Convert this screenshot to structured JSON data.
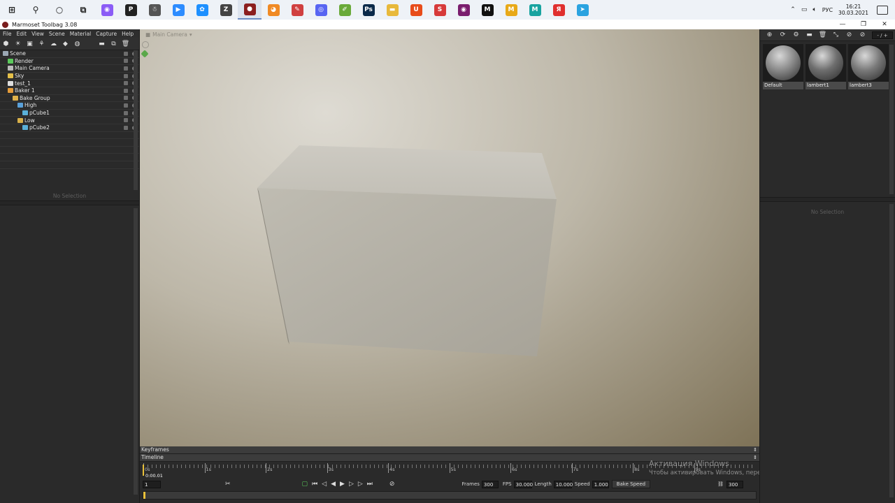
{
  "taskbar": {
    "icons": [
      {
        "name": "windows-start-icon",
        "glyph": "⊞",
        "color": "#222222"
      },
      {
        "name": "search-icon",
        "glyph": "⚲",
        "color": "#222222"
      },
      {
        "name": "cortana-icon",
        "glyph": "○",
        "color": "#222222"
      },
      {
        "name": "task-view-icon",
        "glyph": "⧉",
        "color": "#222222"
      },
      {
        "name": "alice-icon",
        "glyph": "◉",
        "color": "#8b5cf6"
      },
      {
        "name": "chat-app-icon",
        "glyph": "P",
        "color": "#222222"
      },
      {
        "name": "mascot-app-icon",
        "glyph": "☃",
        "color": "#555555"
      },
      {
        "name": "zoom-icon",
        "glyph": "▶",
        "color": "#2d8cff"
      },
      {
        "name": "network-app-icon",
        "glyph": "✿",
        "color": "#1e90ff"
      },
      {
        "name": "zbrush-icon",
        "glyph": "Z",
        "color": "#444444"
      },
      {
        "name": "marmoset-icon",
        "glyph": "●",
        "color": "#8b1e1e"
      },
      {
        "name": "blender-icon",
        "glyph": "◕",
        "color": "#f08a24"
      },
      {
        "name": "paint-app-icon",
        "glyph": "✎",
        "color": "#d04040"
      },
      {
        "name": "discord-icon",
        "glyph": "◎",
        "color": "#5865f2"
      },
      {
        "name": "brush-app-icon",
        "glyph": "✐",
        "color": "#6aaa3a"
      },
      {
        "name": "photoshop-icon",
        "glyph": "Ps",
        "color": "#0b2a4a"
      },
      {
        "name": "folder-icon",
        "glyph": "▬",
        "color": "#e8b93b"
      },
      {
        "name": "ubisoft-icon",
        "glyph": "U",
        "color": "#e84c1a"
      },
      {
        "name": "sp-app-icon",
        "glyph": "S",
        "color": "#d73a3a"
      },
      {
        "name": "obs-icon",
        "glyph": "◉",
        "color": "#7a1d6e"
      },
      {
        "name": "m-app-icon",
        "glyph": "M",
        "color": "#111111"
      },
      {
        "name": "m-yellow-app-icon",
        "glyph": "M",
        "color": "#e8a918"
      },
      {
        "name": "m-teal-app-icon",
        "glyph": "M",
        "color": "#18a3a0"
      },
      {
        "name": "yandex-icon",
        "glyph": "Я",
        "color": "#e0302f"
      },
      {
        "name": "telegram-icon",
        "glyph": "➤",
        "color": "#2aa3e0"
      }
    ],
    "tray": {
      "lang": "РУС",
      "time": "16:21",
      "date": "30.03.2021"
    }
  },
  "window": {
    "title": "Marmoset Toolbag 3.08",
    "controls": [
      "—",
      "❐",
      "✕"
    ]
  },
  "menu": [
    "File",
    "Edit",
    "View",
    "Scene",
    "Material",
    "Capture",
    "Help"
  ],
  "scene_tree": [
    {
      "label": "Scene",
      "indent": 0,
      "icon_color": "#9aa7b3"
    },
    {
      "label": "Render",
      "indent": 1,
      "icon_color": "#5bc85b"
    },
    {
      "label": "Main Camera",
      "indent": 1,
      "icon_color": "#bbbbbb"
    },
    {
      "label": "Sky",
      "indent": 1,
      "icon_color": "#e5c04a"
    },
    {
      "label": "test_1",
      "indent": 1,
      "icon_color": "#dddddd"
    },
    {
      "label": "Baker 1",
      "indent": 1,
      "icon_color": "#e59c3a"
    },
    {
      "label": "Bake Group",
      "indent": 2,
      "icon_color": "#e0b14a"
    },
    {
      "label": "High",
      "indent": 3,
      "icon_color": "#5aa0d8"
    },
    {
      "label": "pCube1",
      "indent": 4,
      "icon_color": "#5ab0d8"
    },
    {
      "label": "Low",
      "indent": 3,
      "icon_color": "#d8b04a"
    },
    {
      "label": "pCube2",
      "indent": 4,
      "icon_color": "#5ab0d8"
    }
  ],
  "left_no_selection": "No Selection",
  "viewport": {
    "camera_label": "Main Camera"
  },
  "timeline": {
    "keyframes_label": "Keyframes",
    "timeline_label": "Timeline",
    "ticks": [
      "0s",
      "1s",
      "2s",
      "3s",
      "4s",
      "5s",
      "6s",
      "7s",
      "8s",
      "9s"
    ],
    "current_time": "0:00.01",
    "frame_field": "1",
    "frames_label": "Frames",
    "frames_value": "300",
    "fps_label": "FPS",
    "fps_value": "30.000",
    "length_label": "Length",
    "length_value": "10.000",
    "speed_label": "Speed",
    "speed_value": "1.000",
    "bake_speed": "Bake Speed",
    "end_frame": "300"
  },
  "watermark": {
    "line1": "Активация Windows",
    "line2": "Чтобы активировать Windows, перейдите в раздел \"Параметры\"."
  },
  "materials": [
    {
      "name": "Default",
      "tone": "#8a8a8a"
    },
    {
      "name": "lambert1",
      "tone": "#6e6e6e"
    },
    {
      "name": "lambert3",
      "tone": "#7a7a7a"
    }
  ],
  "right_no_selection": "No Selection",
  "right_spin": "- / +"
}
